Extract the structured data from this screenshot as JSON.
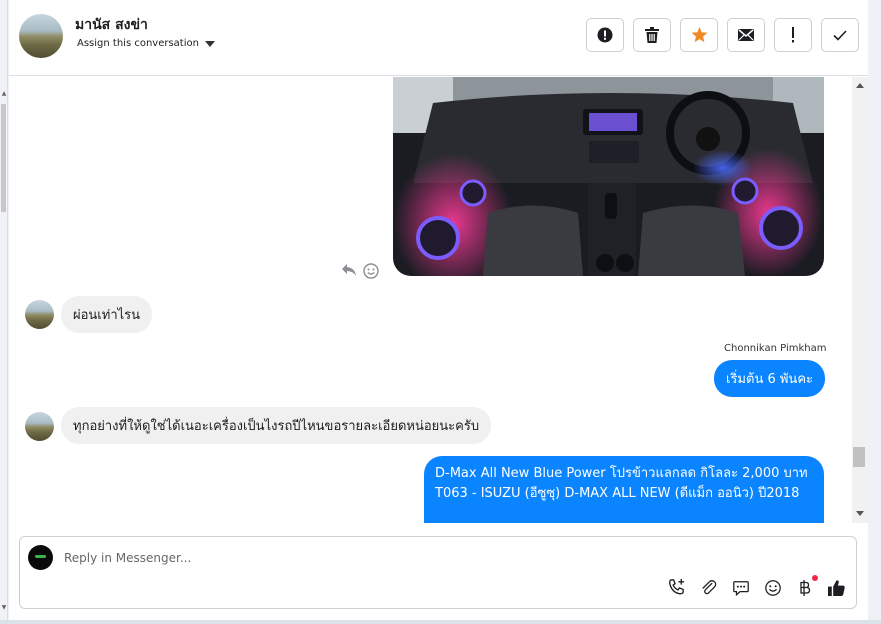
{
  "header": {
    "contact_name": "มานัส สงข่า",
    "assign_label": "Assign this conversation",
    "actions": [
      {
        "name": "spam-button",
        "icon": "alert-circle-icon"
      },
      {
        "name": "delete-button",
        "icon": "trash-icon"
      },
      {
        "name": "star-button",
        "icon": "star-icon"
      },
      {
        "name": "mark-unread-button",
        "icon": "envelope-icon"
      },
      {
        "name": "follow-up-button",
        "icon": "exclamation-icon"
      },
      {
        "name": "mark-done-button",
        "icon": "check-icon"
      }
    ]
  },
  "messages": [
    {
      "type": "image",
      "direction": "out",
      "description_icon": "car-interior-photo"
    },
    {
      "type": "text",
      "direction": "in",
      "text": "ผ่อนเท่าไรน"
    },
    {
      "type": "text",
      "direction": "out",
      "sender": "Chonnikan Pimkham",
      "text": "เริ่มต้น 6 พันคะ"
    },
    {
      "type": "text",
      "direction": "in",
      "text": "ทุกอย่างที่ให้ดูใช่ได้เนอะเครื่องเป็นไงรถปีไหนขอรายละเอียดหน่อยนะครับ"
    },
    {
      "type": "text",
      "direction": "out",
      "lines": [
        "D-Max All New Blue Power โปรข้าวแลกลด กิโลละ 2,000 บาท",
        "T063 - ISUZU (อีซูซุ) D-MAX ALL NEW (ดีแม็ก ออนิว)  ปี2018"
      ]
    }
  ],
  "composer": {
    "placeholder": "Reply in Messenger...",
    "tools": [
      "call-add-icon",
      "paperclip-icon",
      "saved-replies-icon",
      "emoji-icon",
      "baht-payment-icon",
      "thumbs-up-icon"
    ]
  },
  "colors": {
    "accent_blue": "#0b84ff",
    "star_orange": "#f08a24",
    "incoming_bubble": "#f0f0f0",
    "notification_dot": "#f02849"
  }
}
